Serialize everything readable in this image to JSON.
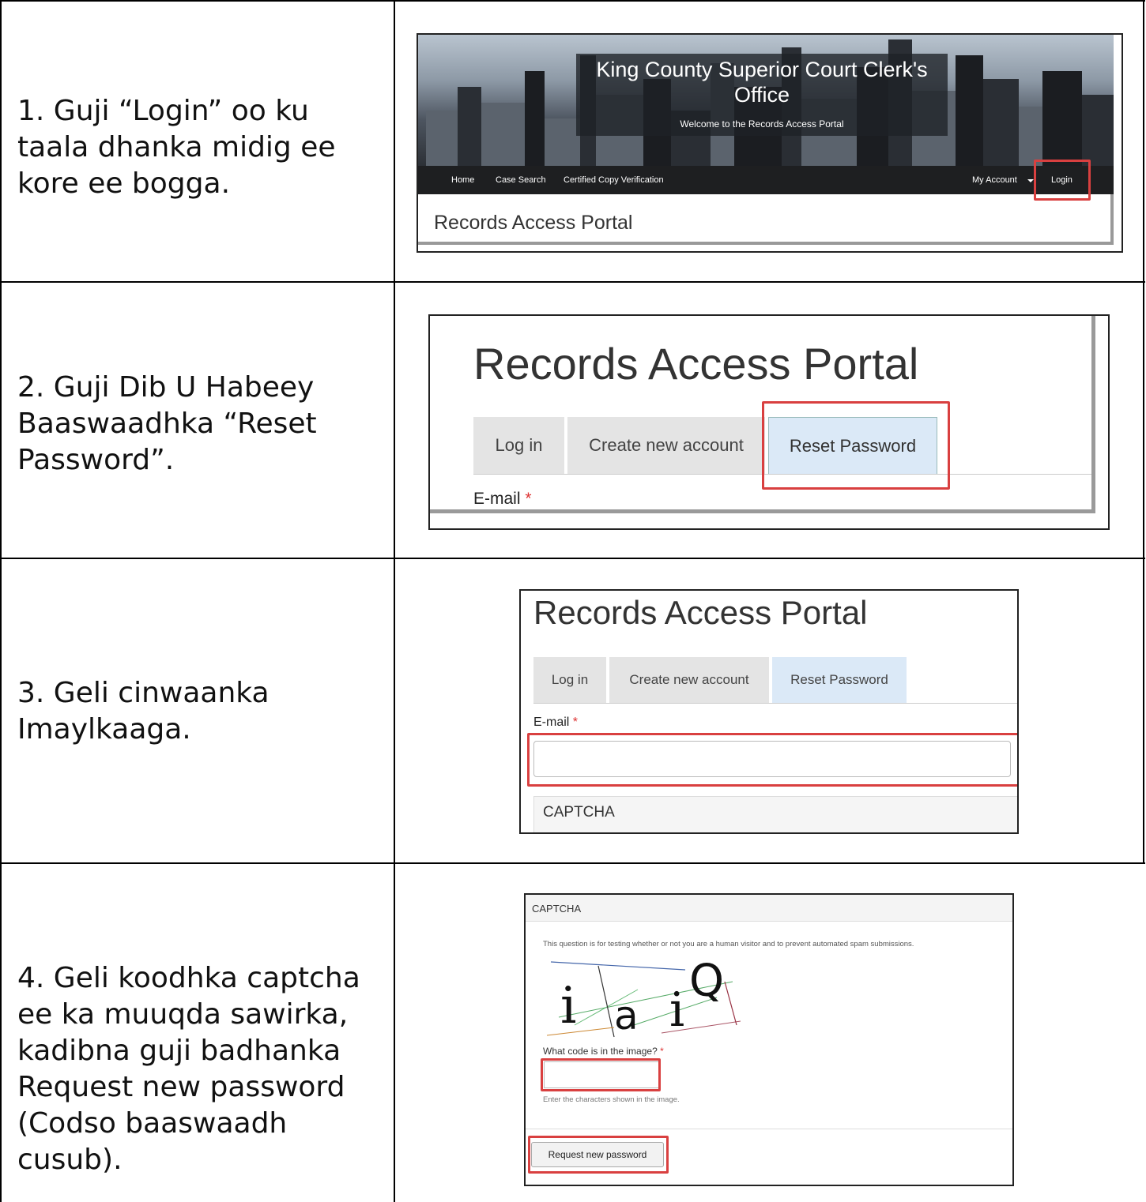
{
  "steps": [
    {
      "text": "1.  Guji “Login” oo ku taala dhanka midig ee kore ee bogga."
    },
    {
      "text": "2.  Guji Dib U Habeey Baaswaadhka “Reset Password”."
    },
    {
      "text": "3.  Geli cinwaanka Imaylkaaga."
    },
    {
      "text": "4.  Geli koodhka captcha ee ka muuqda sawirka, kadibna guji badhanka Request new password (Codso baaswaadh cusub)."
    }
  ],
  "panel1": {
    "banner_title": "King County Superior Court Clerk's Office",
    "banner_subtitle": "Welcome to the Records Access Portal",
    "nav": {
      "home": "Home",
      "case_search": "Case Search",
      "certified_copy": "Certified Copy Verification",
      "my_account": "My Account",
      "login": "Login"
    },
    "page_title": "Records Access Portal"
  },
  "panel2": {
    "title": "Records Access Portal",
    "tabs": [
      "Log in",
      "Create new account",
      "Reset Password"
    ],
    "email_label": "E-mail",
    "required_mark": "*"
  },
  "panel3": {
    "title": "Records Access Portal",
    "tabs": [
      "Log in",
      "Create new account",
      "Reset Password"
    ],
    "email_label": "E-mail",
    "required_mark": "*",
    "email_value": "",
    "captcha_heading": "CAPTCHA"
  },
  "panel4": {
    "captcha_heading": "CAPTCHA",
    "description": "This question is for testing whether or not you are a human visitor and to prevent automated spam submissions.",
    "captcha_chars": [
      "i",
      "a",
      "i",
      "Q"
    ],
    "question": "What code is in the image?",
    "required_mark": "*",
    "code_value": "",
    "help_text": "Enter the characters shown in the image.",
    "submit_label": "Request new password"
  },
  "colors": {
    "highlight": "#d94040",
    "navbar": "#1e1f21",
    "active_tab": "#dbe9f7",
    "required": "#d33333"
  }
}
